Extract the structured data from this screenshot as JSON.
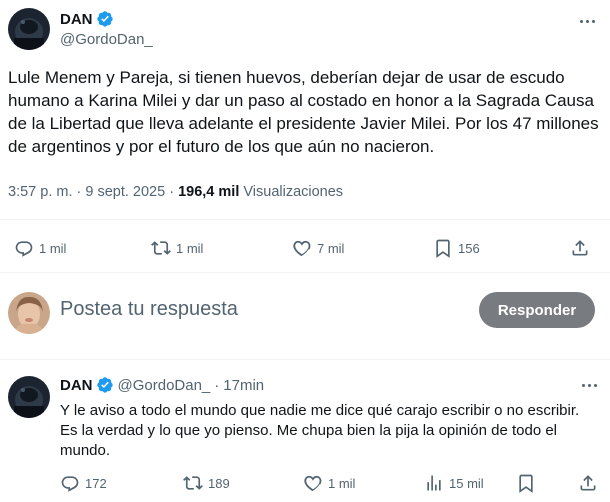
{
  "main_tweet": {
    "display_name": "DAN",
    "handle": "@GordoDan_",
    "text": "Lule Menem y Pareja, si tienen huevos, deberían dejar de usar de escudo humano a Karina Milei y dar un paso al costado en honor a la Sagrada Causa de la Libertad que lleva adelante el presidente Javier Milei. Por los 47 millones de argentinos y por el futuro de los que aún no nacieron.",
    "timestamp": "3:57 p. m. · 9 sept. 2025 · ",
    "views_count": "196,4 mil",
    "views_label": " Visualizaciones",
    "actions": {
      "replies": "1 mil",
      "reposts": "1 mil",
      "likes": "7 mil",
      "bookmarks": "156"
    }
  },
  "reply_box": {
    "placeholder": "Postea tu respuesta",
    "button_label": "Responder"
  },
  "reply_tweet": {
    "display_name": "DAN",
    "handle": "@GordoDan_",
    "separator": "·",
    "time": "17min",
    "text": "Y le aviso a todo el mundo que nadie me dice qué carajo escribir o no escribir. Es la verdad y lo que yo pienso. Me chupa bien la pija la opinión de todo el mundo.",
    "actions": {
      "replies": "172",
      "reposts": "189",
      "likes": "1 mil",
      "views": "15 mil"
    }
  },
  "colors": {
    "text_primary": "#0f1419",
    "text_secondary": "#536471",
    "verified_blue": "#1d9bf0",
    "button_disabled": "#787c80",
    "divider": "#eff3f4"
  },
  "icons": [
    "verified-badge-icon",
    "more-icon",
    "reply-icon",
    "repost-icon",
    "like-icon",
    "bookmark-icon",
    "share-icon",
    "views-icon"
  ]
}
